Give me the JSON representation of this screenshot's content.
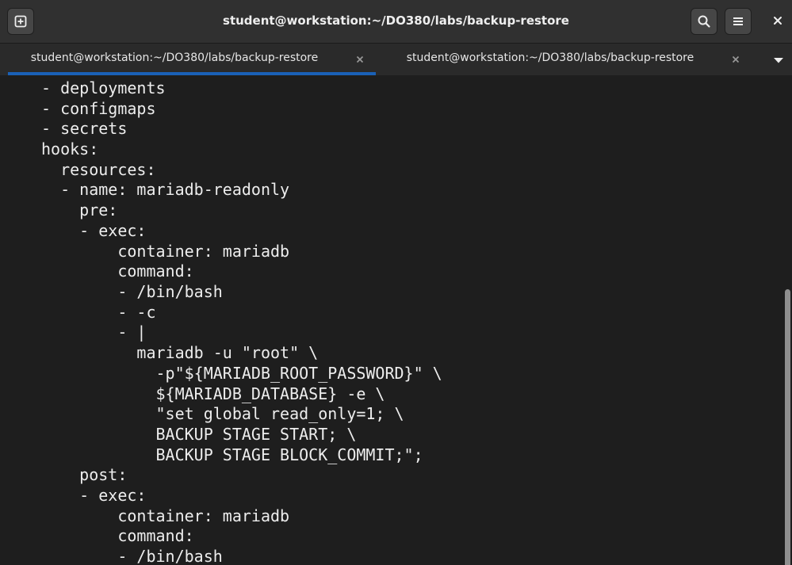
{
  "window": {
    "title": "student@workstation:~/DO380/labs/backup-restore",
    "buttons": {
      "new_tab_icon": "new-tab-icon",
      "search_icon": "search-icon",
      "menu_icon": "hamburger-menu-icon",
      "close_icon": "close-icon"
    }
  },
  "tabs": [
    {
      "label": "student@workstation:~/DO380/labs/backup-restore",
      "active": true
    },
    {
      "label": "student@workstation:~/DO380/labs/backup-restore",
      "active": false
    }
  ],
  "tab_dropdown_icon": "chevron-down-icon",
  "accent_color": "#1a61b7",
  "terminal": {
    "lines": [
      "- deployments",
      "- configmaps",
      "- secrets",
      "hooks:",
      "  resources:",
      "  - name: mariadb-readonly",
      "    pre:",
      "    - exec:",
      "        container: mariadb",
      "        command:",
      "        - /bin/bash",
      "        - -c",
      "        - |",
      "          mariadb -u \"root\" \\",
      "            -p\"${MARIADB_ROOT_PASSWORD}\" \\",
      "            ${MARIADB_DATABASE} -e \\",
      "            \"set global read_only=1; \\",
      "            BACKUP STAGE START; \\",
      "            BACKUP STAGE BLOCK_COMMIT;\";",
      "    post:",
      "    - exec:",
      "        container: mariadb",
      "        command:",
      "        - /bin/bash"
    ]
  }
}
